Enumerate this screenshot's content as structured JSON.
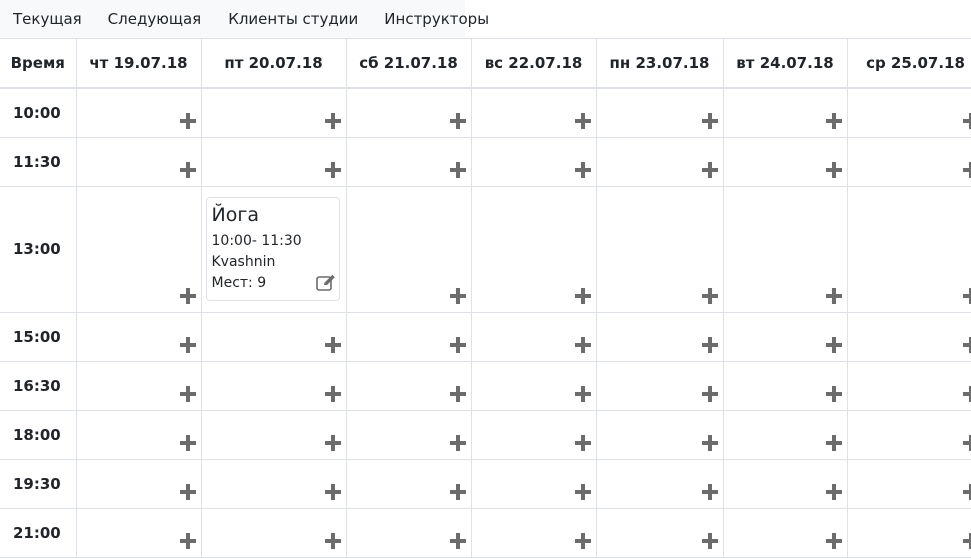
{
  "nav": {
    "tabs": [
      "Текущая",
      "Следующая",
      "Клиенты студии",
      "Инструкторы"
    ]
  },
  "schedule": {
    "time_header": "Время",
    "days": [
      "чт 19.07.18",
      "пт 20.07.18",
      "сб 21.07.18",
      "вс 22.07.18",
      "пн 23.07.18",
      "вт 24.07.18",
      "ср 25.07.18"
    ],
    "times": [
      "10:00",
      "11:30",
      "13:00",
      "15:00",
      "16:30",
      "18:00",
      "19:30",
      "21:00"
    ]
  },
  "event": {
    "title": "Йога",
    "time": "10:00- 11:30",
    "instructor": "Kvashnin",
    "places": "Мест: 9"
  },
  "icons": {
    "add_slot": "plus-icon",
    "edit": "edit-icon"
  },
  "colors": {
    "icon": "#6c6c6c",
    "border": "#dee2e6",
    "nav_bg": "#f8f9fa"
  }
}
